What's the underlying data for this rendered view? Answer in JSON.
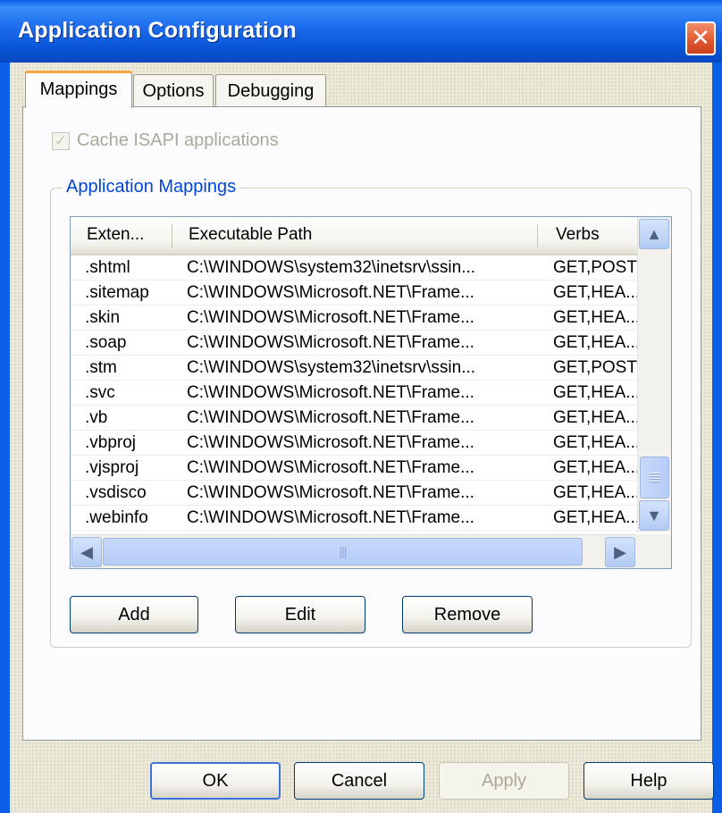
{
  "window": {
    "title": "Application Configuration",
    "close_glyph": "✕"
  },
  "tabs": [
    {
      "label": "Mappings",
      "active": true
    },
    {
      "label": "Options",
      "active": false
    },
    {
      "label": "Debugging",
      "active": false
    }
  ],
  "cache_checkbox": {
    "label": "Cache ISAPI applications",
    "checked": true,
    "enabled": false,
    "glyph": "✓"
  },
  "group": {
    "title": "Application Mappings"
  },
  "mappings": {
    "columns": [
      "Exten...",
      "Executable Path",
      "Verbs"
    ],
    "rows": [
      {
        "ext": ".shtml",
        "path": "C:\\WINDOWS\\system32\\inetsrv\\ssin...",
        "verbs": "GET,POST"
      },
      {
        "ext": ".sitemap",
        "path": "C:\\WINDOWS\\Microsoft.NET\\Frame...",
        "verbs": "GET,HEA..."
      },
      {
        "ext": ".skin",
        "path": "C:\\WINDOWS\\Microsoft.NET\\Frame...",
        "verbs": "GET,HEA..."
      },
      {
        "ext": ".soap",
        "path": "C:\\WINDOWS\\Microsoft.NET\\Frame...",
        "verbs": "GET,HEA..."
      },
      {
        "ext": ".stm",
        "path": "C:\\WINDOWS\\system32\\inetsrv\\ssin...",
        "verbs": "GET,POST"
      },
      {
        "ext": ".svc",
        "path": "C:\\WINDOWS\\Microsoft.NET\\Frame...",
        "verbs": "GET,HEA..."
      },
      {
        "ext": ".vb",
        "path": "C:\\WINDOWS\\Microsoft.NET\\Frame...",
        "verbs": "GET,HEA..."
      },
      {
        "ext": ".vbproj",
        "path": "C:\\WINDOWS\\Microsoft.NET\\Frame...",
        "verbs": "GET,HEA..."
      },
      {
        "ext": ".vjsproj",
        "path": "C:\\WINDOWS\\Microsoft.NET\\Frame...",
        "verbs": "GET,HEA..."
      },
      {
        "ext": ".vsdisco",
        "path": "C:\\WINDOWS\\Microsoft.NET\\Frame...",
        "verbs": "GET,HEA..."
      },
      {
        "ext": ".webinfo",
        "path": "C:\\WINDOWS\\Microsoft.NET\\Frame...",
        "verbs": "GET,HEA..."
      }
    ]
  },
  "scrollbars": {
    "up_glyph": "▲",
    "down_glyph": "▼",
    "left_glyph": "◀",
    "right_glyph": "▶",
    "grip_glyph": "|||"
  },
  "list_buttons": {
    "add": "Add",
    "edit": "Edit",
    "remove": "Remove"
  },
  "dialog_buttons": {
    "ok": "OK",
    "cancel": "Cancel",
    "apply": "Apply",
    "help": "Help"
  }
}
